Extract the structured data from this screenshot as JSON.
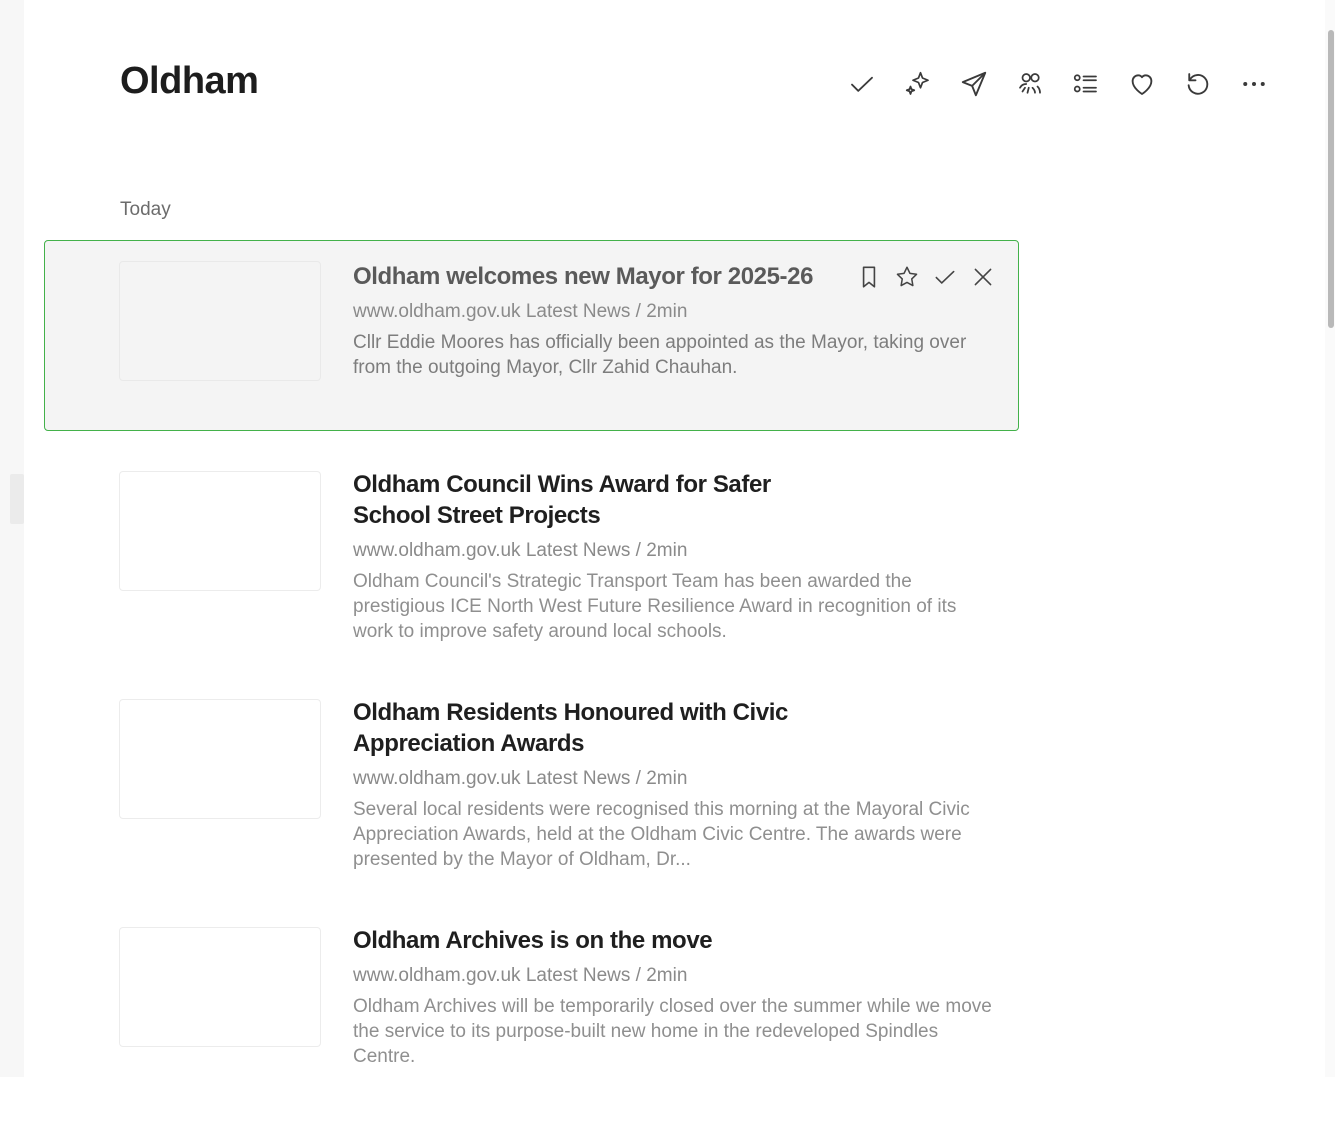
{
  "page": {
    "title": "Oldham"
  },
  "toolbar": {
    "icons": [
      "check-icon",
      "sparkle-icon",
      "send-icon",
      "people-icon",
      "list-icon",
      "heart-icon",
      "refresh-icon",
      "more-icon"
    ]
  },
  "feed": {
    "section_label": "Today",
    "items": [
      {
        "title": "Oldham welcomes new Mayor for 2025-26",
        "meta": "www.oldham.gov.uk Latest News / 2min",
        "summary": "Cllr Eddie Moores has officially been appointed as the Mayor, taking over from the outgoing Mayor, Cllr Zahid Chauhan.",
        "selected": true
      },
      {
        "title": "Oldham Council Wins Award for Safer School Street Projects",
        "meta": "www.oldham.gov.uk Latest News / 2min",
        "summary": "Oldham Council's Strategic Transport Team has been awarded the prestigious ICE North West Future Resilience Award in recognition of its work to improve safety around local schools."
      },
      {
        "title": "Oldham Residents Honoured with Civic Appreciation Awards",
        "meta": "www.oldham.gov.uk Latest News / 2min",
        "summary": "Several local residents were recognised this morning at the Mayoral Civic Appreciation Awards, held at the Oldham Civic Centre. The awards were presented by the Mayor of Oldham, Dr..."
      },
      {
        "title": "Oldham Archives is on the move",
        "meta": "www.oldham.gov.uk Latest News / 2min",
        "summary": "Oldham Archives will be temporarily closed over the summer while we move the service to its purpose-built new home in the redeveloped Spindles Centre."
      }
    ]
  },
  "colors": {
    "selected_border": "#43b14a",
    "selected_bg": "#f4f4f4"
  }
}
